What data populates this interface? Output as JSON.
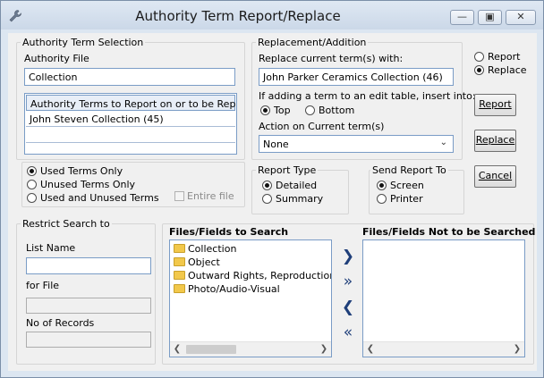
{
  "window": {
    "title": "Authority Term Report/Replace"
  },
  "selection": {
    "group_label": "Authority Term Selection",
    "file_label": "Authority File",
    "file_value": "Collection",
    "list_header": "Authority Terms to Report on or to be Replaced",
    "terms": [
      "John Steven Collection (45)"
    ],
    "scope_options": [
      "Used Terms Only",
      "Unused Terms Only",
      "Used and Unused Terms"
    ],
    "entire_file_label": "Entire file"
  },
  "replacement": {
    "group_label": "Replacement/Addition",
    "replace_label": "Replace current term(s) with:",
    "replace_value": "John Parker Ceramics Collection (46)",
    "insert_label": "If adding a term to an edit table, insert into:",
    "insert_options": [
      "Top",
      "Bottom"
    ],
    "action_label": "Action on Current term(s)",
    "action_value": "None"
  },
  "mode": {
    "options": [
      "Report",
      "Replace"
    ]
  },
  "buttons": {
    "report": "Report",
    "replace": "Replace",
    "cancel": "Cancel"
  },
  "report_type": {
    "label": "Report Type",
    "options": [
      "Detailed",
      "Summary"
    ]
  },
  "send_to": {
    "label": "Send Report To",
    "options": [
      "Screen",
      "Printer"
    ]
  },
  "restrict": {
    "label": "Restrict Search to",
    "list_name_label": "List Name",
    "for_file_label": "for File",
    "records_label": "No of Records"
  },
  "fields": {
    "search_label": "Files/Fields to Search",
    "search_items": [
      "Collection",
      "Object",
      "Outward Rights, Reproduction",
      "Photo/Audio-Visual"
    ],
    "not_search_label": "Files/Fields Not to be Searched"
  }
}
